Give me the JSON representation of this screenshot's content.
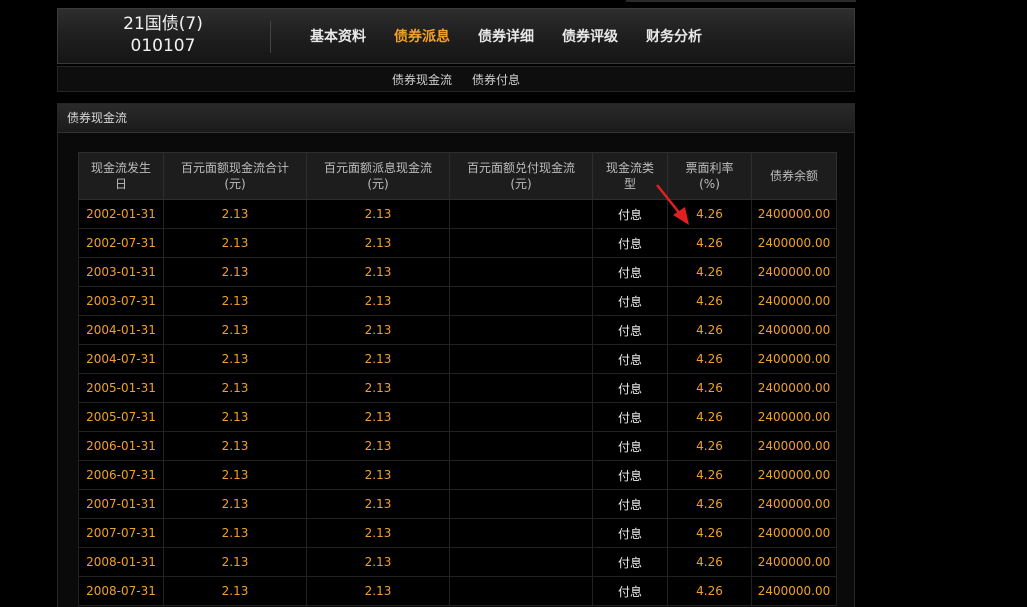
{
  "header": {
    "bond_name": "21国债(7)",
    "bond_code": "010107",
    "nav": [
      {
        "label": "基本资料",
        "active": false
      },
      {
        "label": "债券派息",
        "active": true
      },
      {
        "label": "债券详细",
        "active": false
      },
      {
        "label": "债券评级",
        "active": false
      },
      {
        "label": "财务分析",
        "active": false
      }
    ]
  },
  "subnav": {
    "items": [
      "债券现金流",
      "债券付息"
    ]
  },
  "panel": {
    "title": "债券现金流"
  },
  "table": {
    "headers": [
      [
        "现金流发生",
        "日"
      ],
      [
        "百元面额现金流合计",
        "(元)"
      ],
      [
        "百元面额派息现金流",
        "(元)"
      ],
      [
        "百元面额兑付现金流",
        "(元)"
      ],
      [
        "现金流类",
        "型"
      ],
      [
        "票面利率",
        "(%)"
      ],
      [
        "债券余额",
        ""
      ]
    ],
    "rows": [
      [
        "2002-01-31",
        "2.13",
        "2.13",
        "",
        "付息",
        "4.26",
        "2400000.00"
      ],
      [
        "2002-07-31",
        "2.13",
        "2.13",
        "",
        "付息",
        "4.26",
        "2400000.00"
      ],
      [
        "2003-01-31",
        "2.13",
        "2.13",
        "",
        "付息",
        "4.26",
        "2400000.00"
      ],
      [
        "2003-07-31",
        "2.13",
        "2.13",
        "",
        "付息",
        "4.26",
        "2400000.00"
      ],
      [
        "2004-01-31",
        "2.13",
        "2.13",
        "",
        "付息",
        "4.26",
        "2400000.00"
      ],
      [
        "2004-07-31",
        "2.13",
        "2.13",
        "",
        "付息",
        "4.26",
        "2400000.00"
      ],
      [
        "2005-01-31",
        "2.13",
        "2.13",
        "",
        "付息",
        "4.26",
        "2400000.00"
      ],
      [
        "2005-07-31",
        "2.13",
        "2.13",
        "",
        "付息",
        "4.26",
        "2400000.00"
      ],
      [
        "2006-01-31",
        "2.13",
        "2.13",
        "",
        "付息",
        "4.26",
        "2400000.00"
      ],
      [
        "2006-07-31",
        "2.13",
        "2.13",
        "",
        "付息",
        "4.26",
        "2400000.00"
      ],
      [
        "2007-01-31",
        "2.13",
        "2.13",
        "",
        "付息",
        "4.26",
        "2400000.00"
      ],
      [
        "2007-07-31",
        "2.13",
        "2.13",
        "",
        "付息",
        "4.26",
        "2400000.00"
      ],
      [
        "2008-01-31",
        "2.13",
        "2.13",
        "",
        "付息",
        "4.26",
        "2400000.00"
      ],
      [
        "2008-07-31",
        "2.13",
        "2.13",
        "",
        "付息",
        "4.26",
        "2400000.00"
      ]
    ]
  },
  "colors": {
    "accent": "#f0a02a",
    "annotation_arrow": "#e02020"
  },
  "annotation": {
    "icon": "red-arrow-icon"
  }
}
